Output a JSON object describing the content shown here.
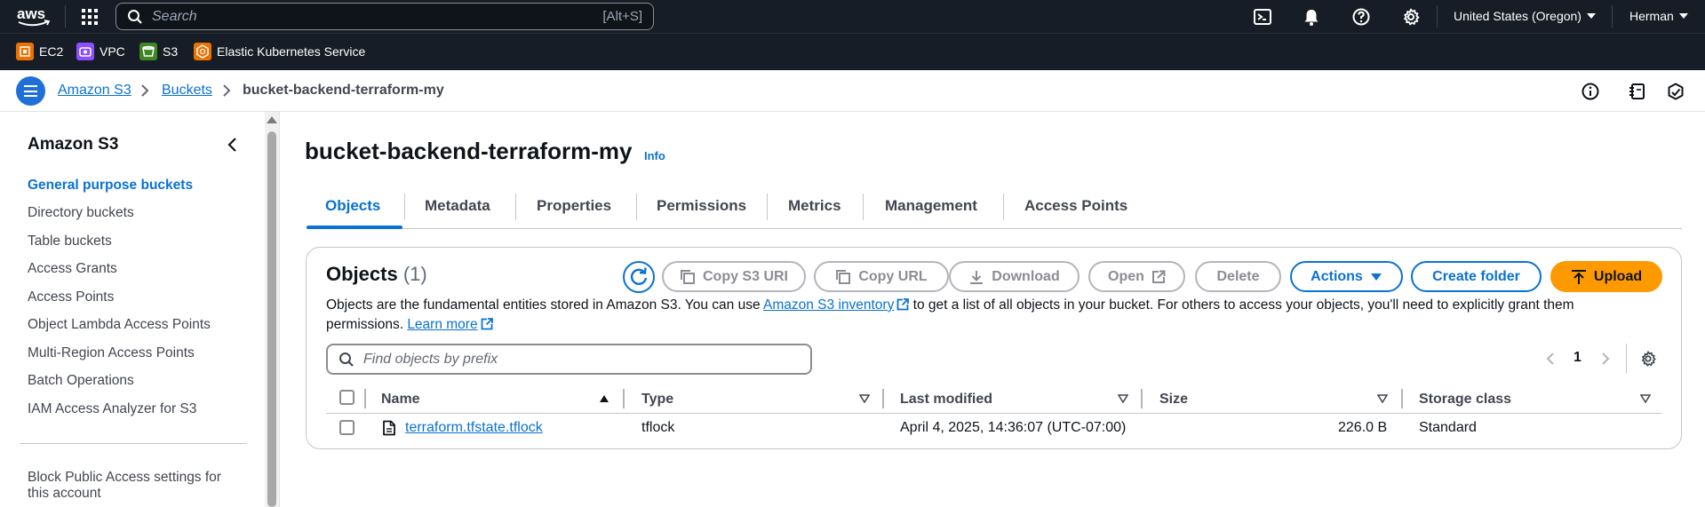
{
  "topnav": {
    "search_placeholder": "Search",
    "search_shortcut": "[Alt+S]",
    "region": "United States (Oregon)",
    "user": "Herman"
  },
  "favorites": [
    {
      "label": "EC2",
      "color": "#ed7100"
    },
    {
      "label": "VPC",
      "color": "#8c4fff"
    },
    {
      "label": "S3",
      "color": "#3f8624"
    },
    {
      "label": "Elastic Kubernetes Service",
      "color": "#ed7100"
    }
  ],
  "breadcrumb": {
    "items": [
      "Amazon S3",
      "Buckets",
      "bucket-backend-terraform-my"
    ]
  },
  "sidebar": {
    "title": "Amazon S3",
    "items": [
      "General purpose buckets",
      "Directory buckets",
      "Table buckets",
      "Access Grants",
      "Access Points",
      "Object Lambda Access Points",
      "Multi-Region Access Points",
      "Batch Operations",
      "IAM Access Analyzer for S3"
    ],
    "footer_line1": "Block Public Access settings for",
    "footer_line2": "this account"
  },
  "main": {
    "title": "bucket-backend-terraform-my",
    "info": "Info",
    "tabs": [
      "Objects",
      "Metadata",
      "Properties",
      "Permissions",
      "Metrics",
      "Management",
      "Access Points"
    ]
  },
  "objects": {
    "title": "Objects",
    "count": "(1)",
    "buttons": {
      "copy_s3_uri": "Copy S3 URI",
      "copy_url": "Copy URL",
      "download": "Download",
      "open": "Open",
      "delete": "Delete",
      "actions": "Actions",
      "create_folder": "Create folder",
      "upload": "Upload"
    },
    "desc_part1": "Objects are the fundamental entities stored in Amazon S3. You can use",
    "desc_link1": "Amazon S3 inventory",
    "desc_part2": "to get a list of all objects in your bucket. For others to access your objects, you'll need to explicitly grant them permissions.",
    "desc_link2": "Learn more",
    "filter_placeholder": "Find objects by prefix",
    "page": "1",
    "columns": [
      "Name",
      "Type",
      "Last modified",
      "Size",
      "Storage class"
    ],
    "rows": [
      {
        "name": "terraform.tfstate.tflock",
        "type": "tflock",
        "last_modified": "April 4, 2025, 14:36:07 (UTC-07:00)",
        "size": "226.0 B",
        "storage_class": "Standard"
      }
    ]
  }
}
